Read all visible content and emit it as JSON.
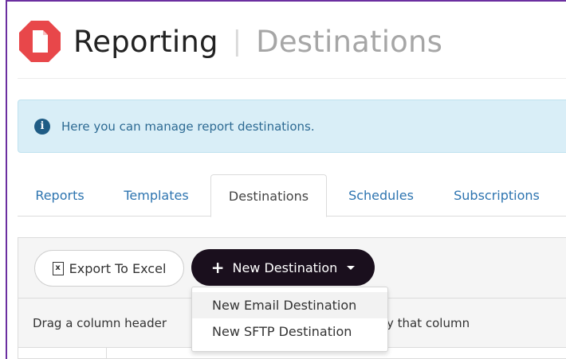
{
  "header": {
    "title": "Reporting",
    "separator": "|",
    "subtitle": "Destinations",
    "brand_color": "#e8474a"
  },
  "info": {
    "icon": "info-circle-icon",
    "text": "Here you can manage report destinations."
  },
  "tabs": [
    {
      "label": "Reports",
      "active": false
    },
    {
      "label": "Templates",
      "active": false
    },
    {
      "label": "Destinations",
      "active": true
    },
    {
      "label": "Schedules",
      "active": false
    },
    {
      "label": "Subscriptions",
      "active": false
    }
  ],
  "toolbar": {
    "export_label": "Export To Excel",
    "new_label": "New Destination"
  },
  "grid": {
    "group_hint_left": "Drag a column header",
    "group_hint_right": "y that column"
  },
  "dropdown": {
    "items": [
      "New Email Destination",
      "New SFTP Destination"
    ]
  }
}
